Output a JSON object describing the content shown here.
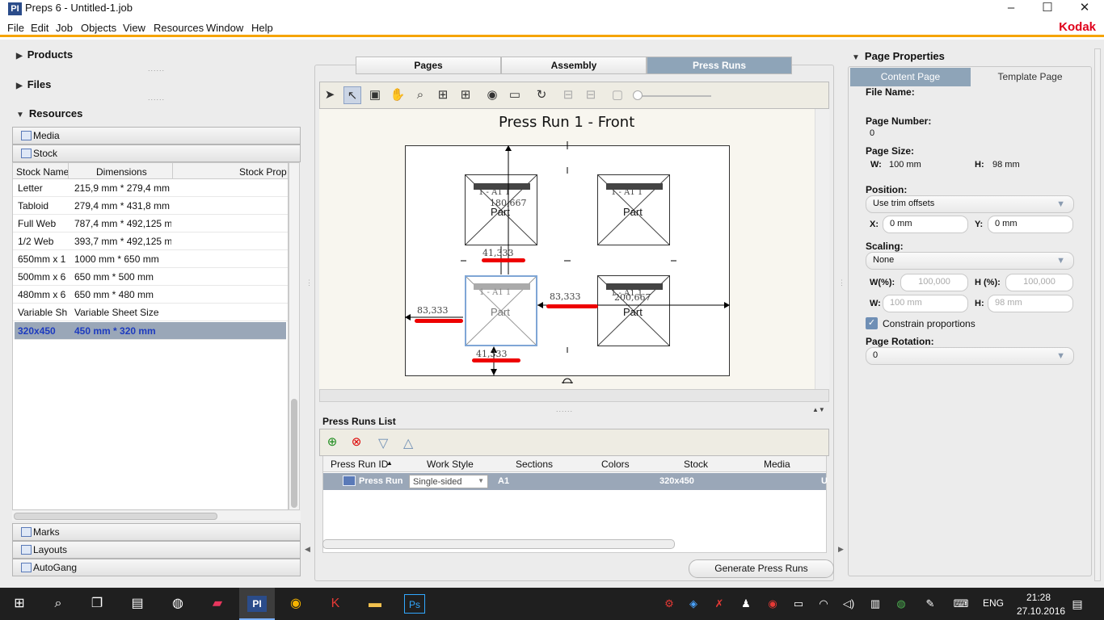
{
  "window": {
    "title": "Preps 6 - Untitled-1.job",
    "app_icon": "PI",
    "min": "–",
    "max": "☐",
    "close": "✕"
  },
  "menu": [
    "File",
    "Edit",
    "Job",
    "Objects",
    "View",
    "Resources",
    "Window",
    "Help"
  ],
  "brand": "Kodak",
  "left": {
    "products": "Products",
    "files": "Files",
    "resources": "Resources",
    "media": "Media",
    "stock": "Stock",
    "columns": [
      "Stock Name",
      "Dimensions",
      "Stock Prop"
    ],
    "rows": [
      [
        "Letter",
        "215,9 mm * 279,4 mm"
      ],
      [
        "Tabloid",
        "279,4 mm * 431,8 mm"
      ],
      [
        "Full Web",
        "787,4 mm * 492,125 m"
      ],
      [
        "1/2 Web",
        "393,7 mm * 492,125 m"
      ],
      [
        "650mm x 1",
        "1000 mm * 650 mm"
      ],
      [
        "500mm x 6",
        "650 mm * 500 mm"
      ],
      [
        "480mm x 6",
        "650 mm * 480 mm"
      ],
      [
        "Variable Sh",
        "Variable Sheet Size"
      ],
      [
        "320x450",
        "450 mm * 320 mm"
      ]
    ],
    "marks": "Marks",
    "layouts": "Layouts",
    "autogang": "AutoGang"
  },
  "center": {
    "tabs": [
      "Pages",
      "Assembly",
      "Press Runs"
    ],
    "canvas_title": "Press Run 1 - Front",
    "page_label": "Part",
    "page_code": "1 - A1 1",
    "dim_a": "83,333",
    "dim_b": "41,333",
    "val_a": "180,667",
    "val_b": "200,667",
    "list_title": "Press Runs List",
    "list_cols": [
      "Press Run ID",
      "Work Style",
      "Sections",
      "Colors",
      "Stock",
      "Media"
    ],
    "list_row": {
      "id": "Press Run",
      "work_style": "Single-sided",
      "sections": "A1",
      "colors": "",
      "stock": "320x450",
      "media": "U"
    },
    "generate": "Generate Press Runs"
  },
  "right": {
    "title": "Page Properties",
    "tabs": [
      "Content Page",
      "Template Page"
    ],
    "file_name_label": "File Name:",
    "page_number_label": "Page Number:",
    "page_number": "0",
    "page_size_label": "Page Size:",
    "w_label": "W:",
    "w_value": "100 mm",
    "h_label": "H:",
    "h_value": "98 mm",
    "position_label": "Position:",
    "position": "Use trim offsets",
    "x_label": "X:",
    "x_value": "0 mm",
    "y_label": "Y:",
    "y_value": "0 mm",
    "scaling_label": "Scaling:",
    "scaling": "None",
    "wpct_label": "W(%):",
    "wpct": "100,000",
    "hpct_label": "H (%):",
    "hpct": "100,000",
    "w2_label": "W:",
    "w2": "100 mm",
    "h2_label": "H:",
    "h2": "98 mm",
    "constrain": "Constrain proportions",
    "rotation_label": "Page Rotation:",
    "rotation": "0"
  },
  "taskbar": {
    "lang": "ENG",
    "time": "21:28",
    "date": "27.10.2016"
  }
}
